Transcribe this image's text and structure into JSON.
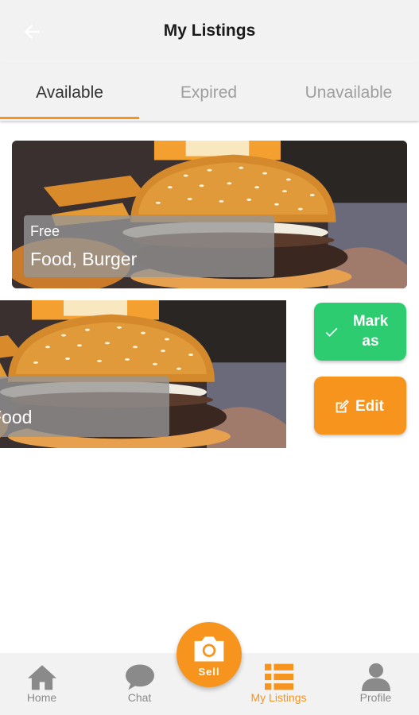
{
  "header": {
    "title": "My Listings"
  },
  "tabs": [
    {
      "label": "Available",
      "active": true
    },
    {
      "label": "Expired",
      "active": false
    },
    {
      "label": "Unavailable",
      "active": false
    }
  ],
  "listings": [
    {
      "price": "Free",
      "name": "Food, Burger"
    },
    {
      "name": "Food"
    }
  ],
  "actions": {
    "mark_label_1": "Mark",
    "mark_label_2": "as",
    "edit_label": "Edit"
  },
  "bottom_nav": {
    "home": "Home",
    "chat": "Chat",
    "sell": "Sell",
    "my_listings": "My Listings",
    "profile": "Profile"
  },
  "colors": {
    "accent": "#f7941d",
    "green": "#2ecc71",
    "inactive": "#8a8a8a"
  }
}
